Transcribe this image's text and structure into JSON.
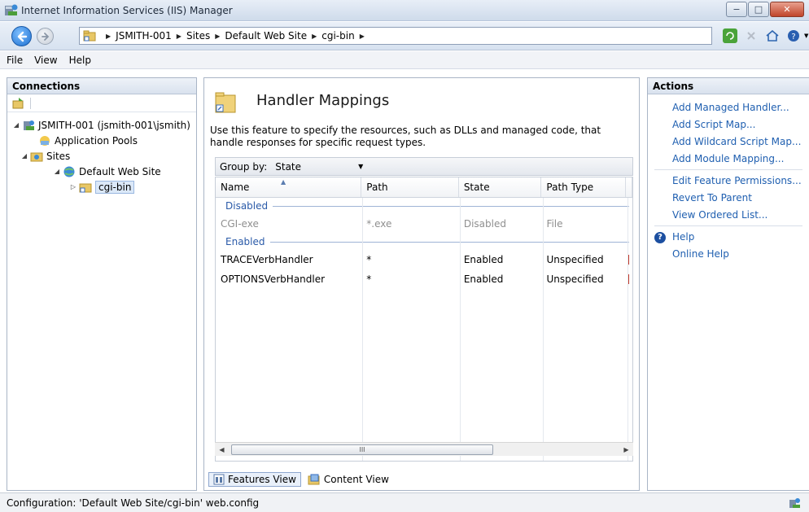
{
  "window": {
    "title": "Internet Information Services (IIS) Manager",
    "buttons": {
      "minimize": "−",
      "maximize": "□",
      "close": "✕"
    }
  },
  "address": {
    "crumbs": [
      "JSMITH-001",
      "Sites",
      "Default Web Site",
      "cgi-bin"
    ]
  },
  "menu": [
    "File",
    "View",
    "Help"
  ],
  "connections": {
    "header": "Connections",
    "tree": [
      {
        "label": "JSMITH-001 (jsmith-001\\jsmith)",
        "level": 0,
        "icon": "server-icon"
      },
      {
        "label": "Application Pools",
        "level": 1,
        "icon": "app-pools-icon"
      },
      {
        "label": "Sites",
        "level": 1,
        "icon": "sites-folder-icon"
      },
      {
        "label": "Default Web Site",
        "level": 2,
        "icon": "globe-icon"
      },
      {
        "label": "cgi-bin",
        "level": 3,
        "icon": "folder-shortcut-icon",
        "selected": true
      }
    ]
  },
  "feature": {
    "title": "Handler Mappings",
    "description": "Use this feature to specify the resources, such as DLLs and managed code, that handle responses for specific request types.",
    "group_by_label": "Group by:",
    "group_by_value": "State"
  },
  "grid": {
    "columns": [
      "Name",
      "Path",
      "State",
      "Path Type"
    ],
    "groups": [
      {
        "label": "Disabled",
        "rows": [
          [
            "CGI-exe",
            "*.exe",
            "Disabled",
            "File"
          ]
        ]
      },
      {
        "label": "Enabled",
        "rows": [
          [
            "TRACEVerbHandler",
            "*",
            "Enabled",
            "Unspecified"
          ],
          [
            "OPTIONSVerbHandler",
            "*",
            "Enabled",
            "Unspecified"
          ]
        ]
      }
    ],
    "scroll_thumb_label": "III"
  },
  "views": {
    "features": "Features View",
    "content": "Content View"
  },
  "actions": {
    "header": "Actions",
    "group1": [
      "Add Managed Handler...",
      "Add Script Map...",
      "Add Wildcard Script Map...",
      "Add Module Mapping..."
    ],
    "group2": [
      "Edit Feature Permissions...",
      "Revert To Parent",
      "View Ordered List..."
    ],
    "help": [
      "Help",
      "Online Help"
    ]
  },
  "status": {
    "text": "Configuration: 'Default Web Site/cgi-bin' web.config"
  },
  "colors": {
    "link": "#1f5fb0",
    "group_header": "#2a5aa8",
    "disabled_text": "#8f8f8f"
  }
}
